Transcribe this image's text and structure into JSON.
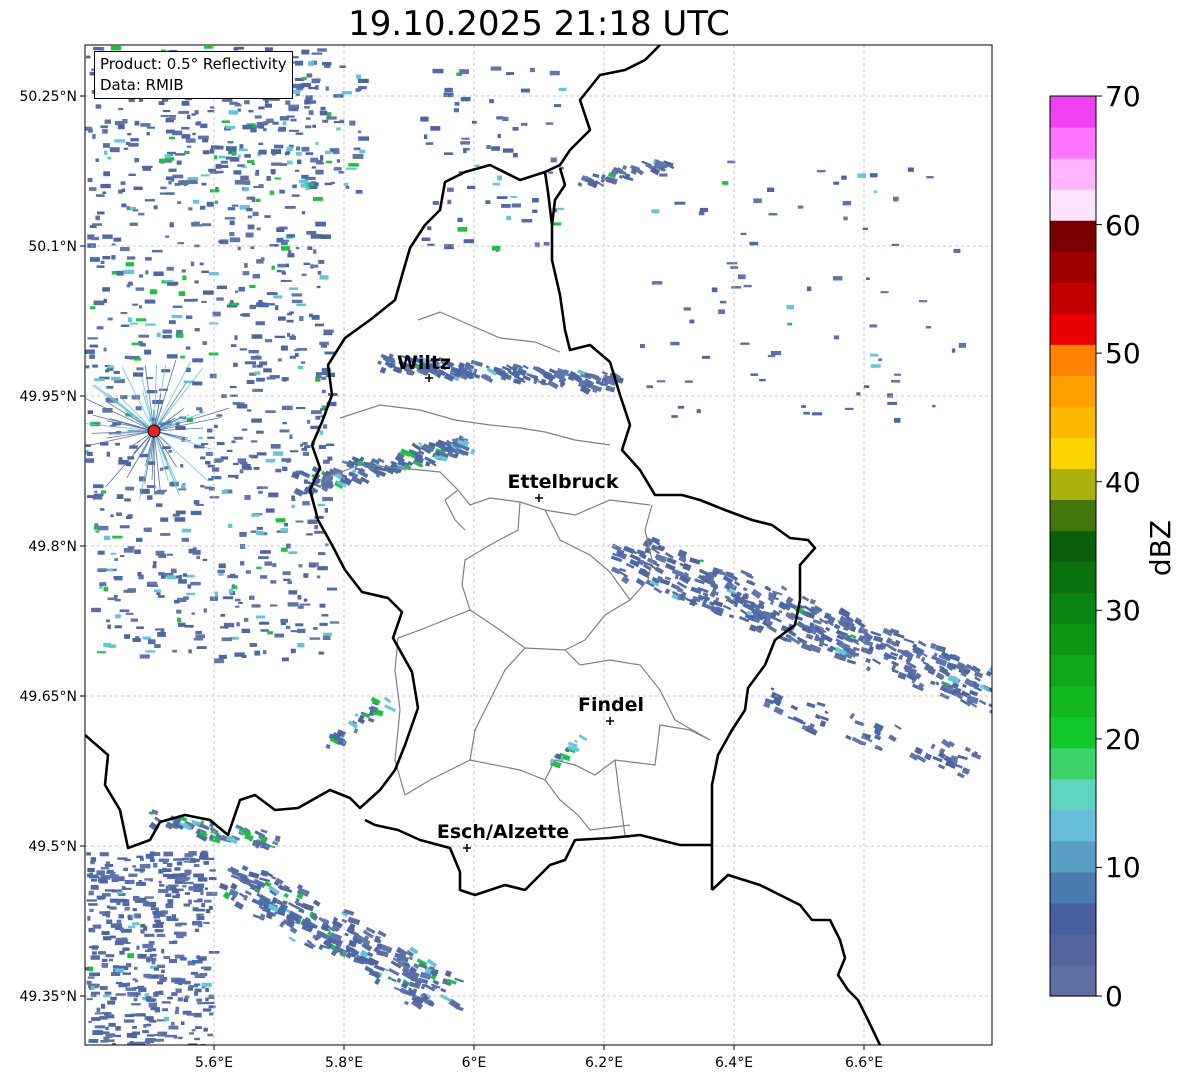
{
  "title": "19.10.2025 21:18 UTC",
  "info": {
    "product": "Product: 0.5° Reflectivity",
    "data": "Data: RMIB"
  },
  "axes": {
    "lon_ticks": [
      "5.6°E",
      "5.8°E",
      "6°E",
      "6.2°E",
      "6.4°E",
      "6.6°E"
    ],
    "lat_ticks": [
      "50.25°N",
      "50.1°N",
      "49.95°N",
      "49.8°N",
      "49.65°N",
      "49.5°N",
      "49.35°N"
    ]
  },
  "cities": [
    {
      "name": "Wiltz"
    },
    {
      "name": "Ettelbruck"
    },
    {
      "name": "Findel"
    },
    {
      "name": "Esch/Alzette"
    }
  ],
  "colorbar": {
    "label": "dBZ",
    "ticks": [
      "0",
      "10",
      "20",
      "30",
      "40",
      "50",
      "60",
      "70"
    ],
    "colors": [
      "#5e6fa3",
      "#53659c",
      "#4760a0",
      "#4a7ab0",
      "#579dc4",
      "#66bedb",
      "#5fd4c0",
      "#3cd46a",
      "#13c82a",
      "#13b81e",
      "#0fa71a",
      "#0d9616",
      "#0a8412",
      "#0a710f",
      "#0b5e0c",
      "#41760c",
      "#aab10b",
      "#ffd500",
      "#ffb800",
      "#ff9f00",
      "#ff8200",
      "#e80000",
      "#c30000",
      "#a00000",
      "#7a0000",
      "#ffe3ff",
      "#ffb5ff",
      "#ff75ff",
      "#f040f0"
    ]
  },
  "colors": {
    "radar_blue": "#5a6fa6",
    "radar_cyan": "#5fc8d8",
    "radar_green": "#19c43c",
    "radar_site": "#e8221f",
    "border": "#000000",
    "canton_border": "#808080",
    "grid": "#b8b8b8"
  }
}
